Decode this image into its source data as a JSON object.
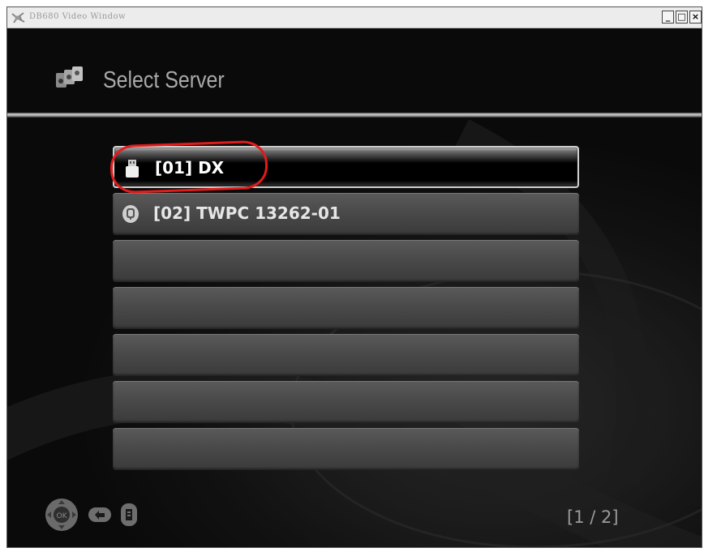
{
  "window": {
    "title": "DB680 Video Window",
    "controls": {
      "minimize": "_",
      "maximize": "□",
      "close": "×"
    }
  },
  "header": {
    "title": "Select Server",
    "icon": "server-cluster-icon"
  },
  "server_list": {
    "selected_index": 0,
    "items": [
      {
        "label": "[01] DX",
        "icon": "usb-drive-icon"
      },
      {
        "label": "[02] TWPC 13262-01",
        "icon": "network-pc-icon"
      },
      {
        "label": ""
      },
      {
        "label": ""
      },
      {
        "label": ""
      },
      {
        "label": ""
      },
      {
        "label": ""
      }
    ]
  },
  "footer": {
    "icons": [
      "remote-control-ok-icon",
      "back-arrow-icon",
      "refresh-icon"
    ],
    "page_indicator": "[1 / 2]"
  },
  "colors": {
    "highlight_ring": "#e21b1b",
    "text": "#e6e6e6",
    "background": "#000000"
  }
}
